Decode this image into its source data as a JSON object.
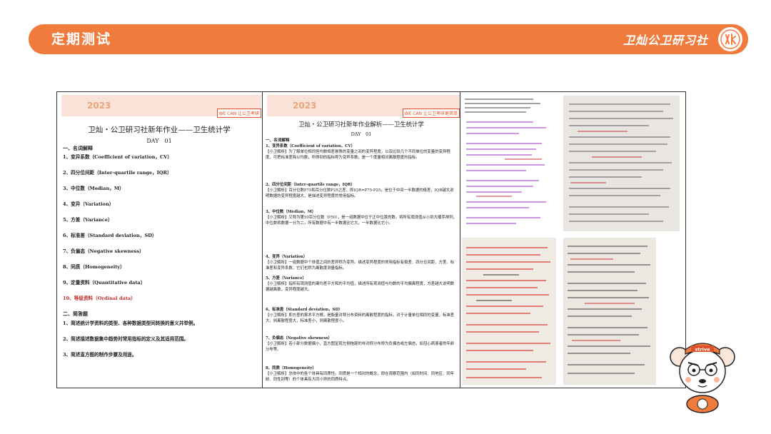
{
  "header": {
    "title": "定期测试",
    "brand": "卫灿公卫研习社"
  },
  "doc1": {
    "year": "2023",
    "tag": "WE CAN 让公卫考研",
    "title": "卫灿・公卫研习社新年作业——卫生统计学",
    "day": "DAY　01",
    "section1": "一、名词解释",
    "terms": [
      "1、变异系数（Coefficient of variation，CV）",
      "2、四分位间距（Inter-quartile range，IQR）",
      "3、中位数（Median，M）",
      "4、变异（Variation）",
      "5、方差（Variance）",
      "6、标准差（Standard deviation，SD）",
      "7、负偏态（Negative skewness）",
      "8、同质（Homogeneity）",
      "9、定量资料（Quantitative data）",
      "10、等级资料（Ordinal data）"
    ],
    "section2": "二、简答题",
    "questions": [
      "1、简述统计学资料的类型、各种数据类型间转换的意义并举例。",
      "2、简述描述数据集中趋势时常用指标的定义及其适用范围。",
      "3、简述直方图的制作步骤及用途。"
    ]
  },
  "doc2": {
    "year": "2023",
    "tag": "WE CAN 让公卫考研更简单",
    "title": "卫灿・公卫研习社新年作业解析——卫生统计学",
    "day": "DAY　01",
    "section1": "一、名词解释",
    "entries": [
      {
        "head": "1、变异系数（Coefficient of variation，CV）",
        "text": "【小卫解析】为了解单位相同但均数相差悬殊的变量之间的变异程度，以及比较几个不同单位的变量的变异程度，可把标准差除以均数，所得到的指标称为变异系数，是一个度量相对离散程度的指标。"
      },
      {
        "head": "2、四分位间距（Inter-quartile range，IQR）",
        "text": "【小卫解析】百分位数P75和百分位数P25之差，即IQR=P75-P25，是位于中间一半数据的极差，IQR越大说明数据的变异程度越大，是描述变异程度的常用指标。"
      },
      {
        "head": "3、中位数（Median，M）",
        "text": "【小卫解析】又称为第50百分位数（P50），是一组数据中位于正中位置的数。将所有观测值从小到大顺序排列，中位数将数据一分为二，所有数据中有一半数据比它大，一半数据比它小。"
      },
      {
        "head": "4、变异（Variation）",
        "text": "【小卫解析】一组数据中个体值之间的差异称为变异。描述变异程度的常用指标有极差、四分位间距、方差、标准差和变异系数，它们也称为离散度测量指标。"
      },
      {
        "head": "5、方差（Variance）",
        "text": "【小卫解析】指所有观测值的离均差平方和的平均值，描述所有观测值与均数的平均偏离程度，方差越大说明数据越离散，变异程度越大。"
      },
      {
        "head": "6、标准差（Standard deviation，SD）",
        "text": "【小卫解析】即方差的算术平方根，是衡量对称分布资料的离散程度的指标，对于计量单位相同的变量，标准差大，则离散程度大，标准差小，则离散程度小。"
      },
      {
        "head": "7、负偏态（Negative skewness）",
        "text": "【小卫解析】若小部分数据偏小，直方图呈现左侧拖尾的非对称分布称为负偏态或左偏态，如冠心病患者的年龄分布等。"
      },
      {
        "head": "8、同质（Homogeneity）",
        "text": "【小卫解析】总体中的各个体具有同质性。同质是一个相对的概念，即在观察范围内（如同时间、同地区、同年龄、同性别等）的个体具有大同小异的同质特点。"
      }
    ]
  }
}
